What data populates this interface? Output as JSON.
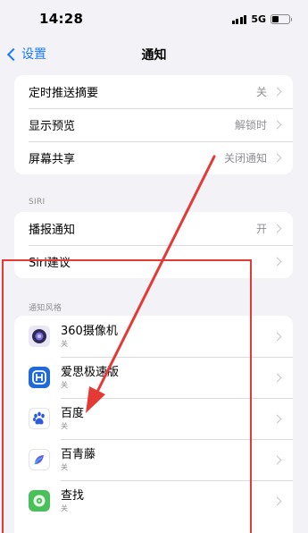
{
  "status_bar": {
    "time": "14:28",
    "network": "5G"
  },
  "nav": {
    "back_label": "设置",
    "title": "通知"
  },
  "group1": {
    "rows": [
      {
        "label": "定时推送摘要",
        "value": "关"
      },
      {
        "label": "显示预览",
        "value": "解锁时"
      },
      {
        "label": "屏幕共享",
        "value": "关闭通知"
      }
    ]
  },
  "siri_section": {
    "header": "SIRI",
    "rows": [
      {
        "label": "播报通知",
        "value": "开"
      },
      {
        "label": "Siri建议",
        "value": ""
      }
    ]
  },
  "style_section": {
    "header": "通知风格",
    "apps": [
      {
        "name": "360摄像机",
        "sub": "关",
        "icon": "camera-360-icon"
      },
      {
        "name": "爱思极速版",
        "sub": "关",
        "icon": "aisi-icon"
      },
      {
        "name": "百度",
        "sub": "关",
        "icon": "baidu-paw-icon"
      },
      {
        "name": "百青藤",
        "sub": "关",
        "icon": "baiqingteng-icon"
      },
      {
        "name": "查找",
        "sub": "关",
        "icon": "find-my-icon"
      }
    ]
  },
  "colors": {
    "accent": "#1a7cf5",
    "annotation": "#e53935",
    "background": "#f2f2f7"
  }
}
